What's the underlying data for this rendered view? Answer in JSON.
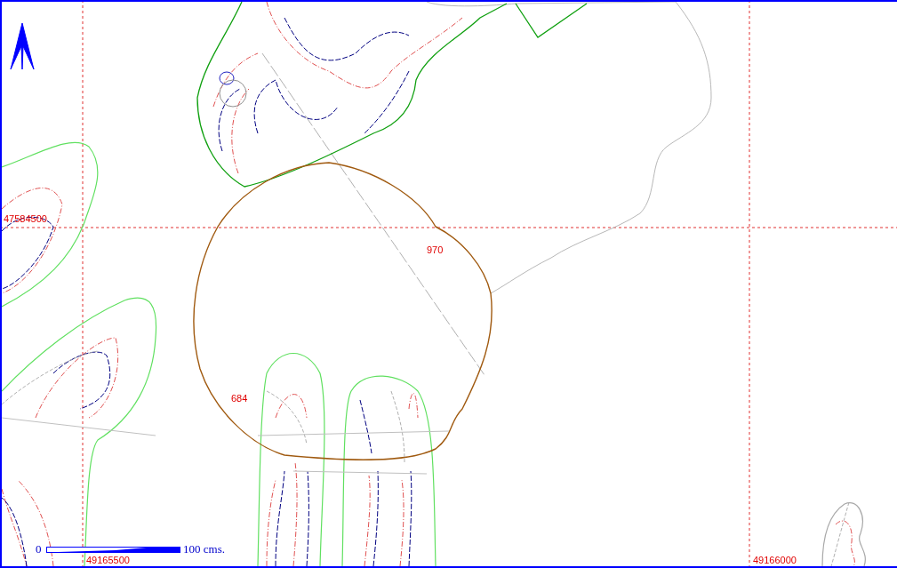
{
  "map": {
    "northing_labels": [
      {
        "text": "47584500"
      }
    ],
    "easting_labels": [
      {
        "text": "49165500"
      },
      {
        "text": "49166000"
      }
    ],
    "contour_labels": [
      {
        "text": "970"
      },
      {
        "text": "684"
      }
    ],
    "scale_bar": {
      "start": "0",
      "end": "100 cms."
    }
  }
}
